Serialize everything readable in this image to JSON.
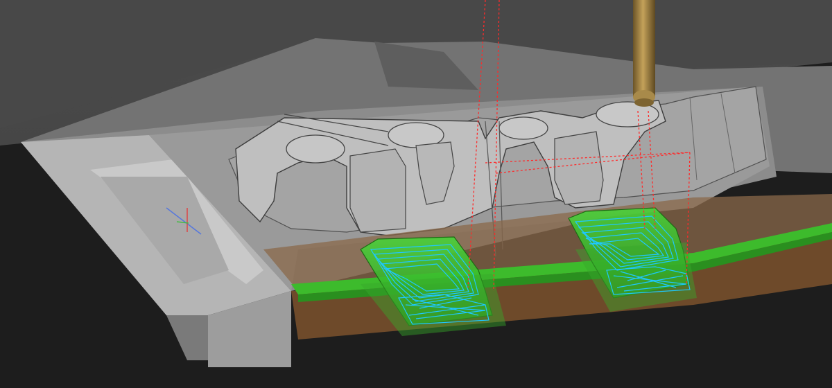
{
  "app": {
    "view": "3d-cam-toolpath-viewport"
  },
  "viewport": {
    "background_color": "#4a4a4a",
    "floor_color": "#1f1f1f",
    "mold_color": "#8f8f8f",
    "toolpath_color": "#1ec8ff",
    "pocket_color": "#39d52a",
    "stock_color": "#8a5a2e",
    "link_color": "#ff2a2a",
    "tool_color": "#9a7a3a"
  },
  "objects": [
    {
      "name": "mold-part",
      "icon": "mesh-icon"
    },
    {
      "name": "cutting-tool",
      "icon": "ball-end-mill-icon"
    },
    {
      "name": "pocket-left",
      "icon": "toolpath-icon"
    },
    {
      "name": "pocket-right",
      "icon": "toolpath-icon"
    },
    {
      "name": "stock",
      "icon": "stock-icon"
    }
  ]
}
